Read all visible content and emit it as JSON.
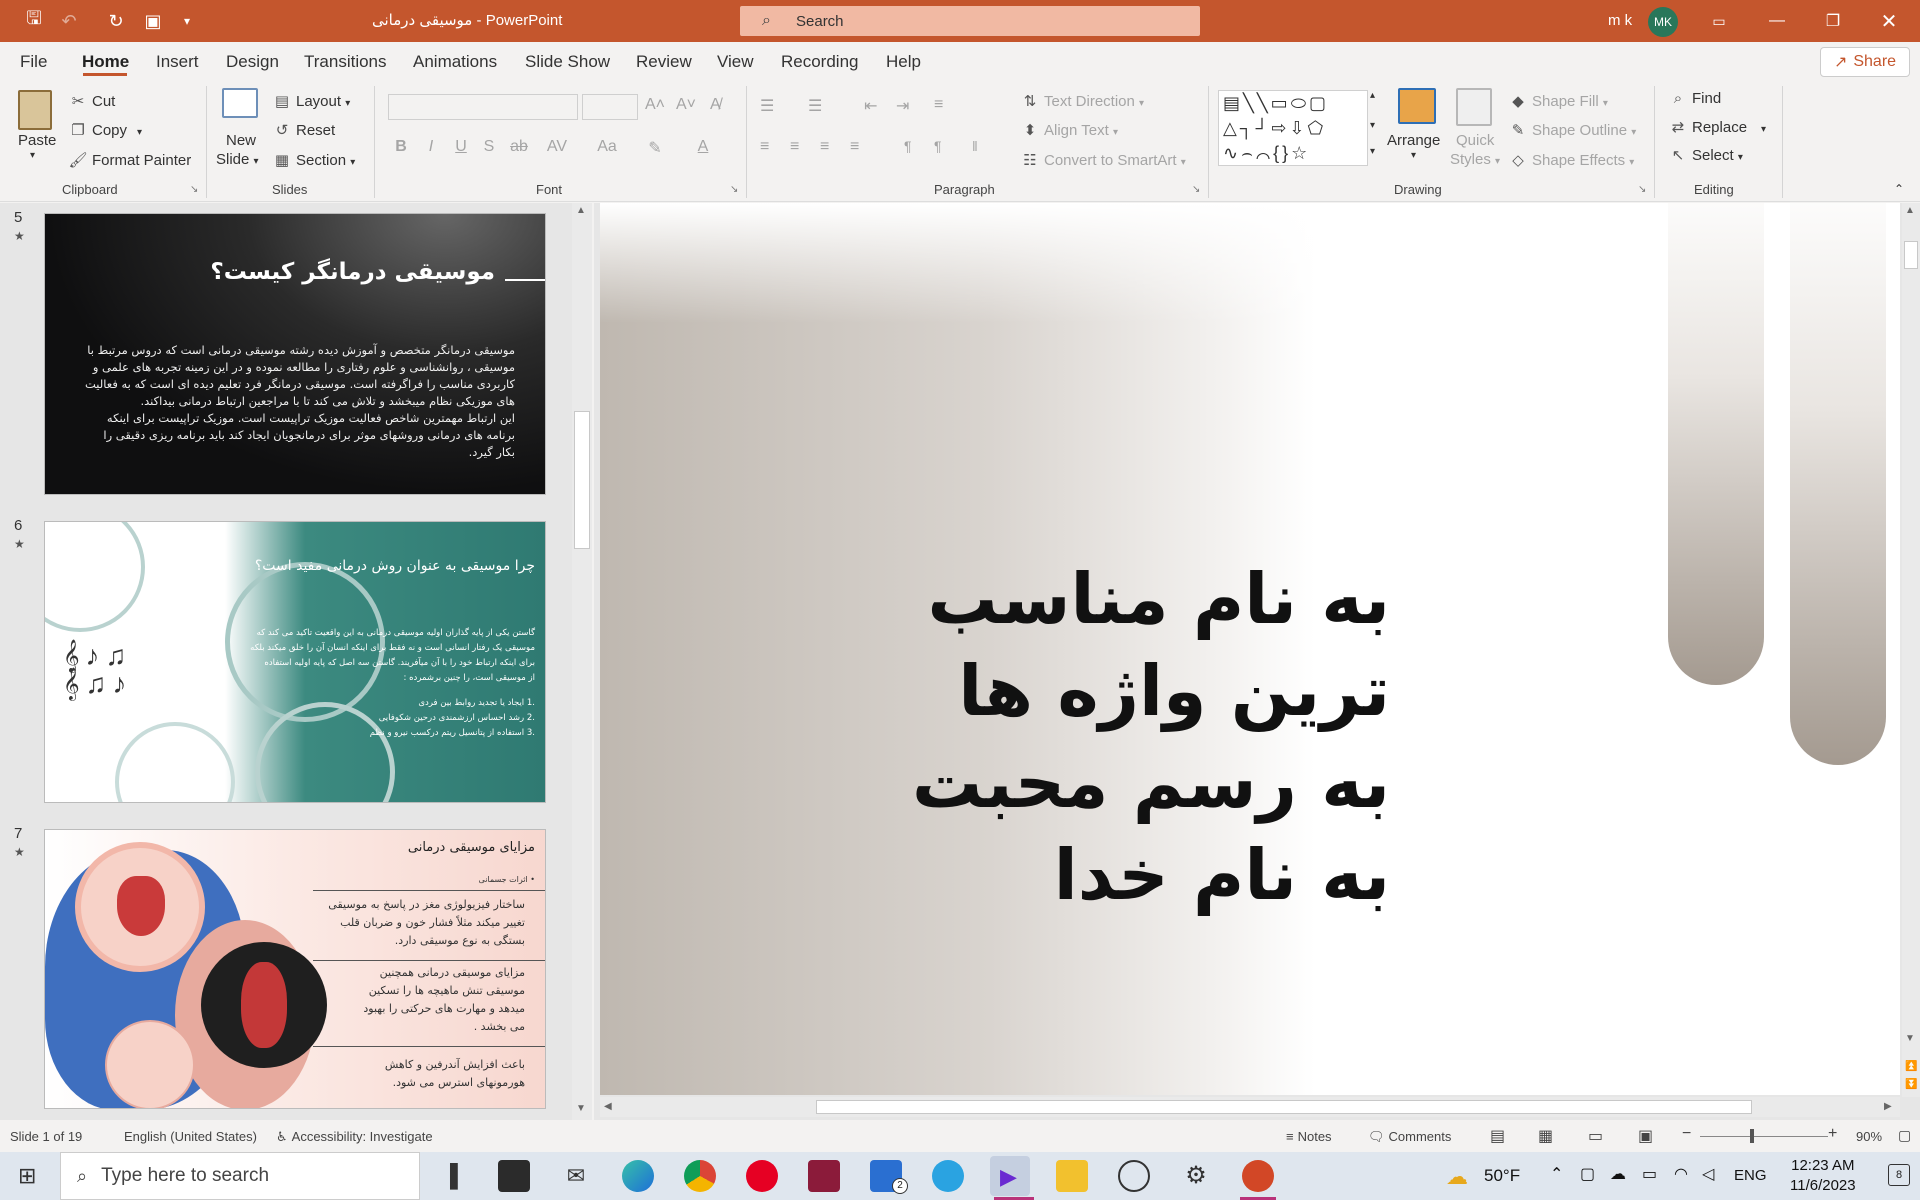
{
  "app": {
    "doc_title": "موسیقی درمانی",
    "app_name": "PowerPoint",
    "title_sep": "-"
  },
  "search": {
    "placeholder": "Search"
  },
  "user": {
    "name": "m k",
    "initials": "MK"
  },
  "menu": {
    "tabs": [
      "File",
      "Home",
      "Insert",
      "Design",
      "Transitions",
      "Animations",
      "Slide Show",
      "Review",
      "View",
      "Recording",
      "Help"
    ],
    "active": "Home",
    "share": "Share"
  },
  "ribbon": {
    "clipboard": {
      "label": "Clipboard",
      "paste": "Paste",
      "cut": "Cut",
      "copy": "Copy",
      "format_painter": "Format Painter"
    },
    "slides": {
      "label": "Slides",
      "new_slide_1": "New",
      "new_slide_2": "Slide",
      "layout": "Layout",
      "reset": "Reset",
      "section": "Section"
    },
    "font": {
      "label": "Font"
    },
    "paragraph": {
      "label": "Paragraph",
      "text_direction": "Text Direction",
      "align_text": "Align Text",
      "convert_smartart": "Convert to SmartArt"
    },
    "drawing": {
      "label": "Drawing",
      "arrange": "Arrange",
      "quick_styles_1": "Quick",
      "quick_styles_2": "Styles",
      "shape_fill": "Shape Fill",
      "shape_outline": "Shape Outline",
      "shape_effects": "Shape Effects"
    },
    "editing": {
      "label": "Editing",
      "find": "Find",
      "replace": "Replace",
      "select": "Select"
    }
  },
  "thumbnails": [
    {
      "number": "5",
      "title": "موسیقی درمانگر کیست؟",
      "lines": [
        "موسیقی درمانگر متخصص و آموزش دیده رشته موسیقی درمانی است که دروس مرتبط با",
        "موسیقی ، روانشناسی و علوم رفتاری را مطالعه نموده و در این زمینه تجربه های علمی و",
        "کاربردی مناسب را فراگرفته است. موسیقی درمانگر فرد تعلیم دیده ای است که به فعالیت",
        "های موزیکی نظام میبخشد و تلاش می کند تا با مراجعین ارتباط درمانی بیداکند.",
        "این ارتباط مهمترین شاخص فعالیت موزیک تراپیست است. موزیک تراپیست برای اینکه",
        "برنامه های درمانی وروشهای موثر برای درمانجویان ایجاد کند باید برنامه ریزی دقیقی را",
        "بکار گیرد."
      ]
    },
    {
      "number": "6",
      "title": "چرا موسیقی به عنوان روش درمانی مفید است؟",
      "lines": [
        "گاستن یکی از پایه گذاران اولیه موسیقی درمانی به این واقعیت تاکید می کند که",
        "موسیقی یک رفتار انسانی است و نه فقط برای اینکه انسان آن را خلق میکند بلکه",
        "برای اینکه ارتباط خود را با آن میآفریند. گاستن سه اصل که پایه اولیه استفاده",
        "از موسیقی است، را چنین برشمرده :"
      ],
      "list": [
        "ایجاد یا تجدید روابط بین فردی",
        "رشد احساس ارزشمندی درحین شکوفایی",
        "استفاده از پتانسیل ریتم درکسب نیرو و نظم"
      ]
    },
    {
      "number": "7",
      "title": "مزایای موسیقی درمانی",
      "bullet": "اثرات جسمانی",
      "blocks": [
        [
          "ساختار فیزیولوژی مغز در پاسخ به موسیقی",
          "تغییر میکند مثلاً فشار خون و ضربان قلب",
          "بستگی به نوع موسیقی دارد."
        ],
        [
          "مزایای موسیقی درمانی همچنین",
          "موسیقی تنش ماهیچه ها را تسکین",
          "میدهد و مهارت های حرکتی را بهبود",
          "می بخشد ."
        ],
        [
          "باعث افزایش آندرفین و کاهش",
          "هورمونهای استرس می شود."
        ]
      ]
    }
  ],
  "slide": {
    "line1": "به نام مناسب ترین واژه ها",
    "line2": "به رسم محبت به نام خدا"
  },
  "status": {
    "slide_info": "Slide 1 of 19",
    "language": "English (United States)",
    "accessibility": "Accessibility: Investigate",
    "notes": "Notes",
    "comments": "Comments",
    "zoom": "90%"
  },
  "taskbar": {
    "search_placeholder": "Type here to search",
    "weather": "50°F",
    "lang": "ENG",
    "time": "12:23 AM",
    "date": "11/6/2023",
    "teams_badge": "2",
    "notif_badge": "8"
  }
}
